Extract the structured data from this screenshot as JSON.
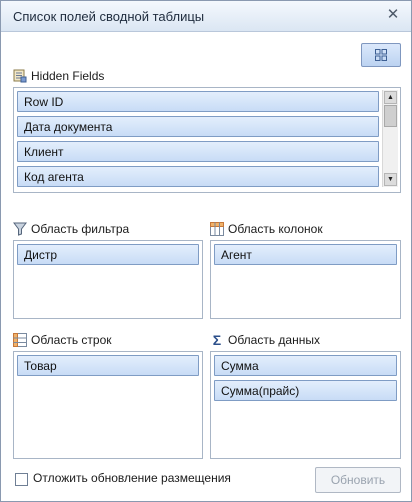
{
  "window": {
    "title": "Список полей сводной таблицы",
    "close_glyph": "✕"
  },
  "toolbar": {
    "layout_button_icon": "layout-grid-icon"
  },
  "hidden_fields": {
    "label": "Hidden Fields",
    "items": [
      "Row ID",
      "Дата документа",
      "Клиент",
      "Код агента"
    ]
  },
  "filter_area": {
    "label": "Область фильтра",
    "items": [
      "Дистр"
    ]
  },
  "column_area": {
    "label": "Область колонок",
    "items": [
      "Агент"
    ]
  },
  "row_area": {
    "label": "Область строк",
    "items": [
      "Товар"
    ]
  },
  "data_area": {
    "label": "Область данных",
    "items": [
      "Сумма",
      "Сумма(прайс)"
    ]
  },
  "footer": {
    "defer_label": "Отложить обновление размещения",
    "defer_checked": false,
    "update_button": "Обновить"
  },
  "colors": {
    "item_border": "#7f9cc4",
    "item_fill": "#c8dcf6",
    "title_bar": "#dbe6f3"
  }
}
